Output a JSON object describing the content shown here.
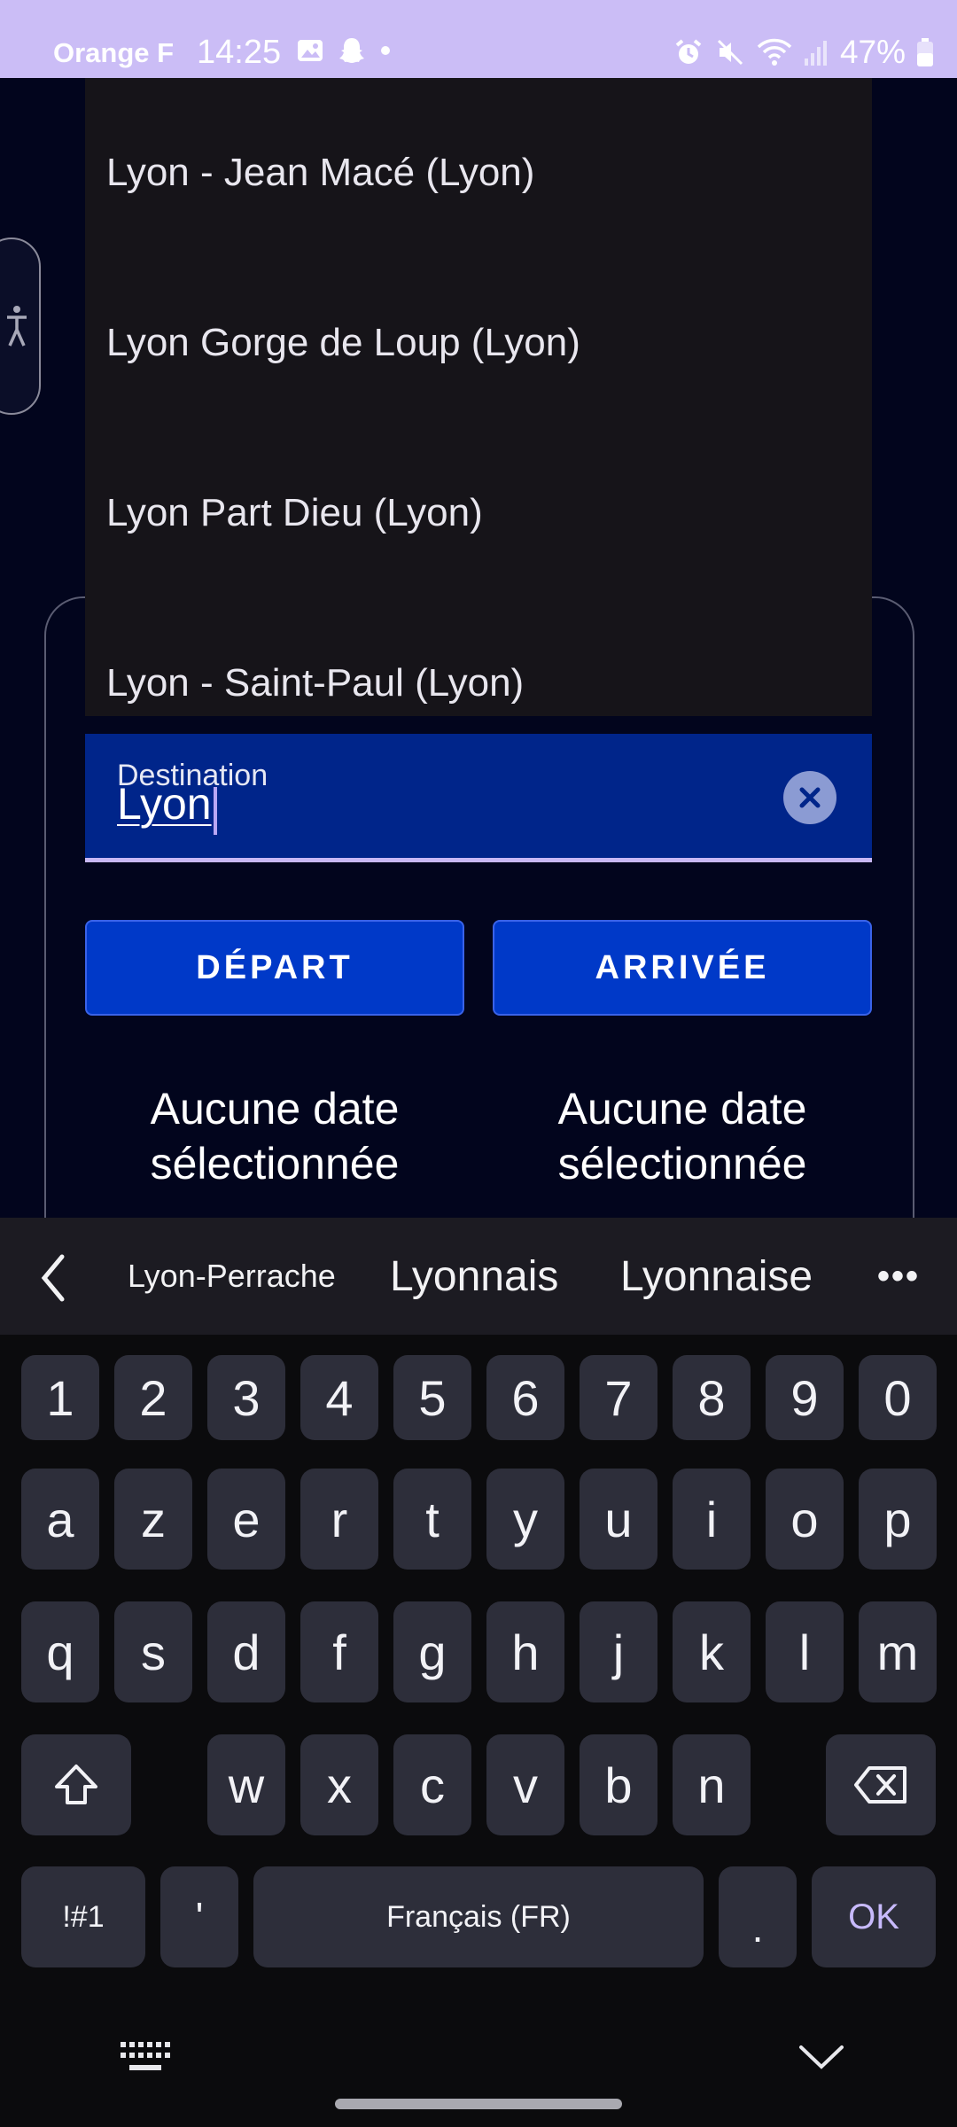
{
  "status_bar": {
    "carrier": "Orange F",
    "time": "14:25",
    "battery": "47%"
  },
  "suggestions_dropdown": {
    "items": [
      "Lyon - Jean Macé (Lyon)",
      "Lyon Gorge de Loup (Lyon)",
      "Lyon Part Dieu (Lyon)",
      "Lyon - Saint-Paul (Lyon)"
    ]
  },
  "destination_field": {
    "label": "Destination",
    "value": "Lyon"
  },
  "buttons": {
    "depart": "DÉPART",
    "arrivee": "ARRIVÉE"
  },
  "dates": {
    "depart_line1": "Aucune date",
    "depart_line2": "sélectionnée",
    "arrivee_line1": "Aucune date",
    "arrivee_line2": "sélectionnée"
  },
  "keyboard": {
    "suggestions": [
      "Lyon-Perrache",
      "Lyonnais",
      "Lyonnaise"
    ],
    "more": "•••",
    "row_numbers": [
      "1",
      "2",
      "3",
      "4",
      "5",
      "6",
      "7",
      "8",
      "9",
      "0"
    ],
    "row1": [
      "a",
      "z",
      "e",
      "r",
      "t",
      "y",
      "u",
      "i",
      "o",
      "p"
    ],
    "row2": [
      "q",
      "s",
      "d",
      "f",
      "g",
      "h",
      "j",
      "k",
      "l",
      "m"
    ],
    "row3": [
      "w",
      "x",
      "c",
      "v",
      "b",
      "n"
    ],
    "symbols_key": "!#1",
    "apostrophe_key": "'",
    "space_key": "Français (FR)",
    "period_key": ".",
    "ok_key": "OK"
  },
  "colors": {
    "status_bar": "#cbbdf6",
    "app_background": "#02051d",
    "field_background": "#00258a",
    "button_background": "#0039c8",
    "accent": "#c8b8f5"
  }
}
